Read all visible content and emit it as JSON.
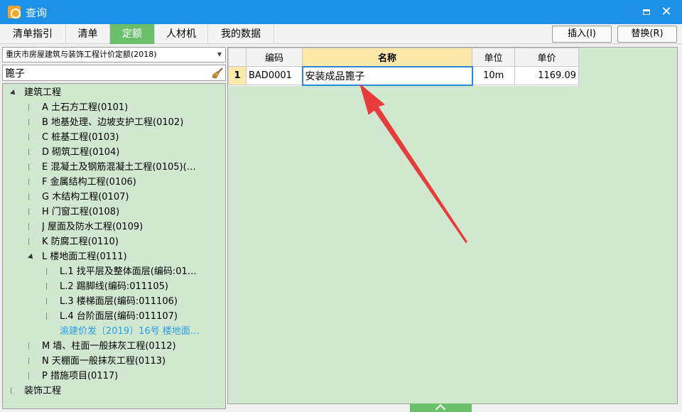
{
  "window": {
    "title": "查询"
  },
  "tabs": [
    {
      "label": "清单指引",
      "active": false
    },
    {
      "label": "清单",
      "active": false
    },
    {
      "label": "定额",
      "active": true
    },
    {
      "label": "人材机",
      "active": false
    },
    {
      "label": "我的数据",
      "active": false
    }
  ],
  "toolbar": {
    "insert_label": "插入(I)",
    "replace_label": "替换(R)"
  },
  "left": {
    "quota_library": "重庆市房屋建筑与装饰工程计价定额(2018)",
    "search_value": "篦子"
  },
  "tree": [
    {
      "label": "建筑工程",
      "state": "expanded"
    },
    {
      "label": "A  土石方工程(0101)",
      "state": "collapsed"
    },
    {
      "label": "B  地基处理、边坡支护工程(0102)",
      "state": "collapsed"
    },
    {
      "label": "C  桩基工程(0103)",
      "state": "collapsed"
    },
    {
      "label": "D  砌筑工程(0104)",
      "state": "collapsed"
    },
    {
      "label": "E  混凝土及钢筋混凝土工程(0105)(…",
      "state": "collapsed"
    },
    {
      "label": "F  金属结构工程(0106)",
      "state": "collapsed"
    },
    {
      "label": "G  木结构工程(0107)",
      "state": "collapsed"
    },
    {
      "label": "H  门窗工程(0108)",
      "state": "collapsed"
    },
    {
      "label": "J  屋面及防水工程(0109)",
      "state": "collapsed"
    },
    {
      "label": "K  防腐工程(0110)",
      "state": "collapsed"
    },
    {
      "label": "L  楼地面工程(0111)",
      "state": "expanded"
    },
    {
      "label": "L.1  找平层及整体面层(编码:01…",
      "state": "collapsed"
    },
    {
      "label": "L.2  踢脚线(编码:011105)",
      "state": "collapsed"
    },
    {
      "label": "L.3  楼梯面层(编码:011106)",
      "state": "collapsed"
    },
    {
      "label": "L.4  台阶面层(编码:011107)",
      "state": "collapsed"
    },
    {
      "label": "渝建价发〔2019〕16号  楼地面…",
      "state": "link"
    },
    {
      "label": "M  墙、柱面一般抹灰工程(0112)",
      "state": "collapsed"
    },
    {
      "label": "N  天棚面一般抹灰工程(0113)",
      "state": "collapsed"
    },
    {
      "label": "P  措施项目(0117)",
      "state": "collapsed"
    },
    {
      "label": "装饰工程",
      "state": "collapsed"
    }
  ],
  "grid": {
    "headers": {
      "code": "编码",
      "name": "名称",
      "unit": "单位",
      "price": "单价"
    },
    "rows": [
      {
        "index": "1",
        "code": "BAD0001",
        "name": "安装成品篦子",
        "unit": "10m",
        "price": "1169.09"
      }
    ]
  },
  "colors": {
    "accent_green": "#6cc06c",
    "panel_green": "#cfe8cf",
    "titlebar_blue": "#1e90e8",
    "annotation_red": "#e83c3c",
    "link_blue": "#2a9ee8"
  }
}
